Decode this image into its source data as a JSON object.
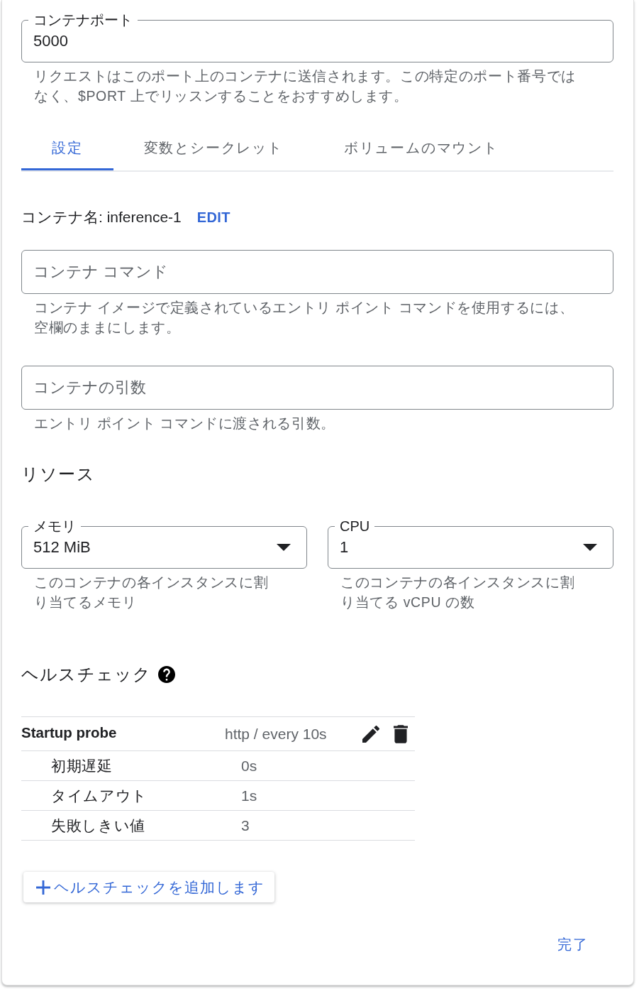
{
  "port_field": {
    "label": "コンテナポート",
    "value": "5000",
    "helper": "リクエストはこのポート上のコンテナに送信されます。この特定のポート番号ではなく、$PORT 上でリッスンすることをおすすめします。"
  },
  "tabs": [
    {
      "label": "設定",
      "selected": true
    },
    {
      "label": "変数とシークレット",
      "selected": false
    },
    {
      "label": "ボリュームのマウント",
      "selected": false
    }
  ],
  "container_name": {
    "text": "コンテナ名: inference-1",
    "action": "EDIT"
  },
  "command_field": {
    "placeholder": "コンテナ コマンド",
    "helper": "コンテナ イメージで定義されているエントリ ポイント コマンドを使用するには、空欄のままにします。"
  },
  "args_field": {
    "placeholder": "コンテナの引数",
    "helper": "エントリ ポイント コマンドに渡される引数。"
  },
  "resources": {
    "heading": "リソース",
    "selects": [
      {
        "label": "メモリ",
        "value": "512 MiB",
        "helper": "このコンテナの各インスタンスに割り当てるメモリ"
      },
      {
        "label": "CPU",
        "value": "1",
        "helper": "このコンテナの各インスタンスに割り当てる vCPU の数"
      }
    ]
  },
  "health_check": {
    "heading": "ヘルスチェック",
    "probes": [
      {
        "name": "Startup probe",
        "summary": "http / every 10s",
        "settings": [
          {
            "label": "初期遅延",
            "value": "0s"
          },
          {
            "label": "タイムアウト",
            "value": "1s"
          },
          {
            "label": "失敗しきい値",
            "value": "3"
          }
        ]
      }
    ],
    "add_button": "ヘルスチェックを追加します"
  },
  "done_button": "完了"
}
